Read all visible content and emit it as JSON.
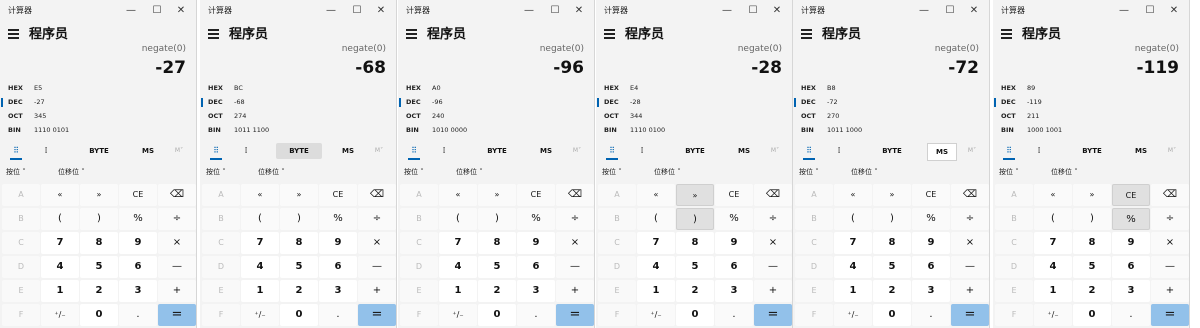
{
  "app": {
    "title": "计算器",
    "mode": "程序员",
    "window_controls": {
      "minimize": "—",
      "maximize": "☐",
      "close": "✕"
    }
  },
  "radix_labels": [
    "HEX",
    "DEC",
    "OCT",
    "BIN"
  ],
  "toolbar": {
    "keypad_icon": "⠿",
    "bit_toggle_icon": "⁞",
    "word_size": "BYTE",
    "ms": "MS",
    "mstar": "M˅"
  },
  "operators": {
    "bitwise": "按位 ˅",
    "bitshift": "位移位 ˅"
  },
  "keypad": [
    [
      "A",
      "«",
      "»",
      "CE",
      "⌫"
    ],
    [
      "B",
      "(",
      ")",
      "%",
      "÷"
    ],
    [
      "C",
      "7",
      "8",
      "9",
      "×"
    ],
    [
      "D",
      "4",
      "5",
      "6",
      "—"
    ],
    [
      "E",
      "1",
      "2",
      "3",
      "+"
    ],
    [
      "F",
      "⁺∕₋",
      "0",
      ".",
      "="
    ]
  ],
  "instances": [
    {
      "expression": "negate(0)",
      "result": "-27",
      "hex": "E5",
      "dec": "-27",
      "oct": "345",
      "bin": "1110 0101"
    },
    {
      "expression": "negate(0)",
      "result": "-68",
      "hex": "BC",
      "dec": "-68",
      "oct": "274",
      "bin": "1011 1100"
    },
    {
      "expression": "negate(0)",
      "result": "-96",
      "hex": "A0",
      "dec": "-96",
      "oct": "240",
      "bin": "1010 0000"
    },
    {
      "expression": "negate(0)",
      "result": "-28",
      "hex": "E4",
      "dec": "-28",
      "oct": "344",
      "bin": "1110 0100"
    },
    {
      "expression": "negate(0)",
      "result": "-72",
      "hex": "B8",
      "dec": "-72",
      "oct": "270",
      "bin": "1011 1000"
    },
    {
      "expression": "negate(0)",
      "result": "-119",
      "hex": "89",
      "dec": "-119",
      "oct": "211",
      "bin": "1000 1001"
    }
  ],
  "highlights": {
    "byte_hover_instance": 1,
    "ms_hover_instance": 4,
    "key_hover": [
      {
        "instance": 3,
        "row": 0,
        "col": 2
      },
      {
        "instance": 3,
        "row": 1,
        "col": 2
      },
      {
        "instance": 5,
        "row": 0,
        "col": 3
      },
      {
        "instance": 5,
        "row": 1,
        "col": 3
      }
    ]
  },
  "colors": {
    "accent": "#0063b1",
    "equals": "#92c1ea",
    "background": "#f3f3f3",
    "key": "#fafafa",
    "number_key": "#ffffff"
  }
}
